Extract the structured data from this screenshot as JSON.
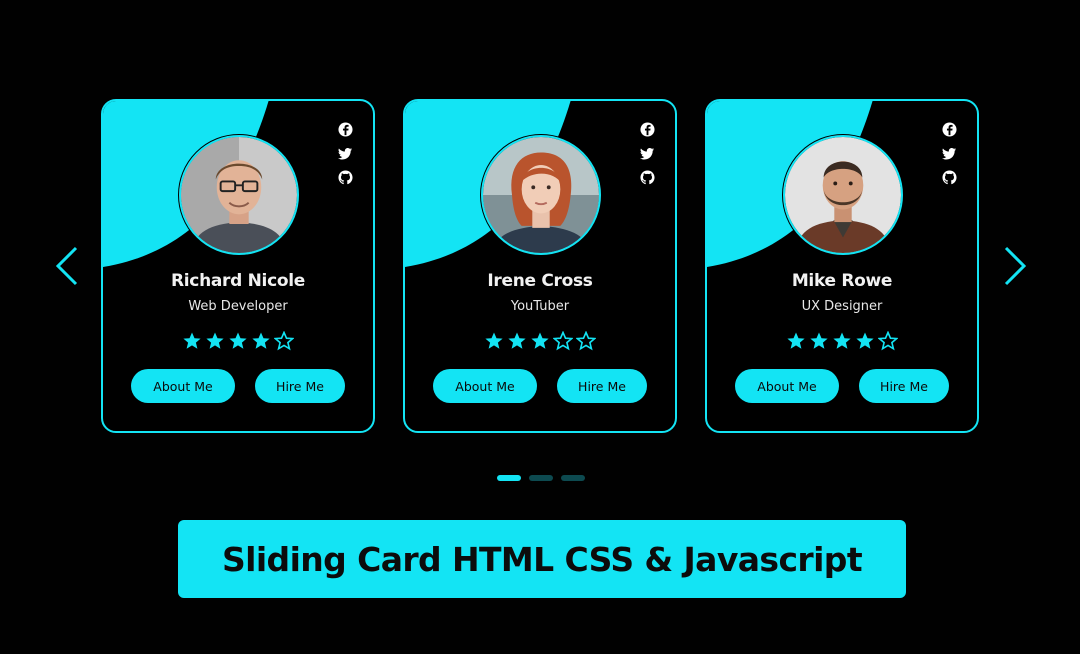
{
  "colors": {
    "accent": "#13e4f4",
    "background": "#000000",
    "text": "#f2f2f2"
  },
  "navigation": {
    "prev_icon": "chevron-left-icon",
    "next_icon": "chevron-right-icon"
  },
  "cards": [
    {
      "name": "Richard Nicole",
      "role": "Web Developer",
      "rating": 4,
      "rating_max": 5,
      "about_label": "About Me",
      "hire_label": "Hire Me",
      "socials": [
        "facebook-icon",
        "twitter-icon",
        "github-icon"
      ]
    },
    {
      "name": "Irene Cross",
      "role": "YouTuber",
      "rating": 3,
      "rating_max": 5,
      "about_label": "About Me",
      "hire_label": "Hire Me",
      "socials": [
        "facebook-icon",
        "twitter-icon",
        "github-icon"
      ]
    },
    {
      "name": "Mike Rowe",
      "role": "UX Designer",
      "rating": 4,
      "rating_max": 5,
      "about_label": "About Me",
      "hire_label": "Hire Me",
      "socials": [
        "facebook-icon",
        "twitter-icon",
        "github-icon"
      ]
    }
  ],
  "pagination": {
    "total": 3,
    "active": 0
  },
  "banner": {
    "title": "Sliding Card HTML CSS & Javascript"
  }
}
